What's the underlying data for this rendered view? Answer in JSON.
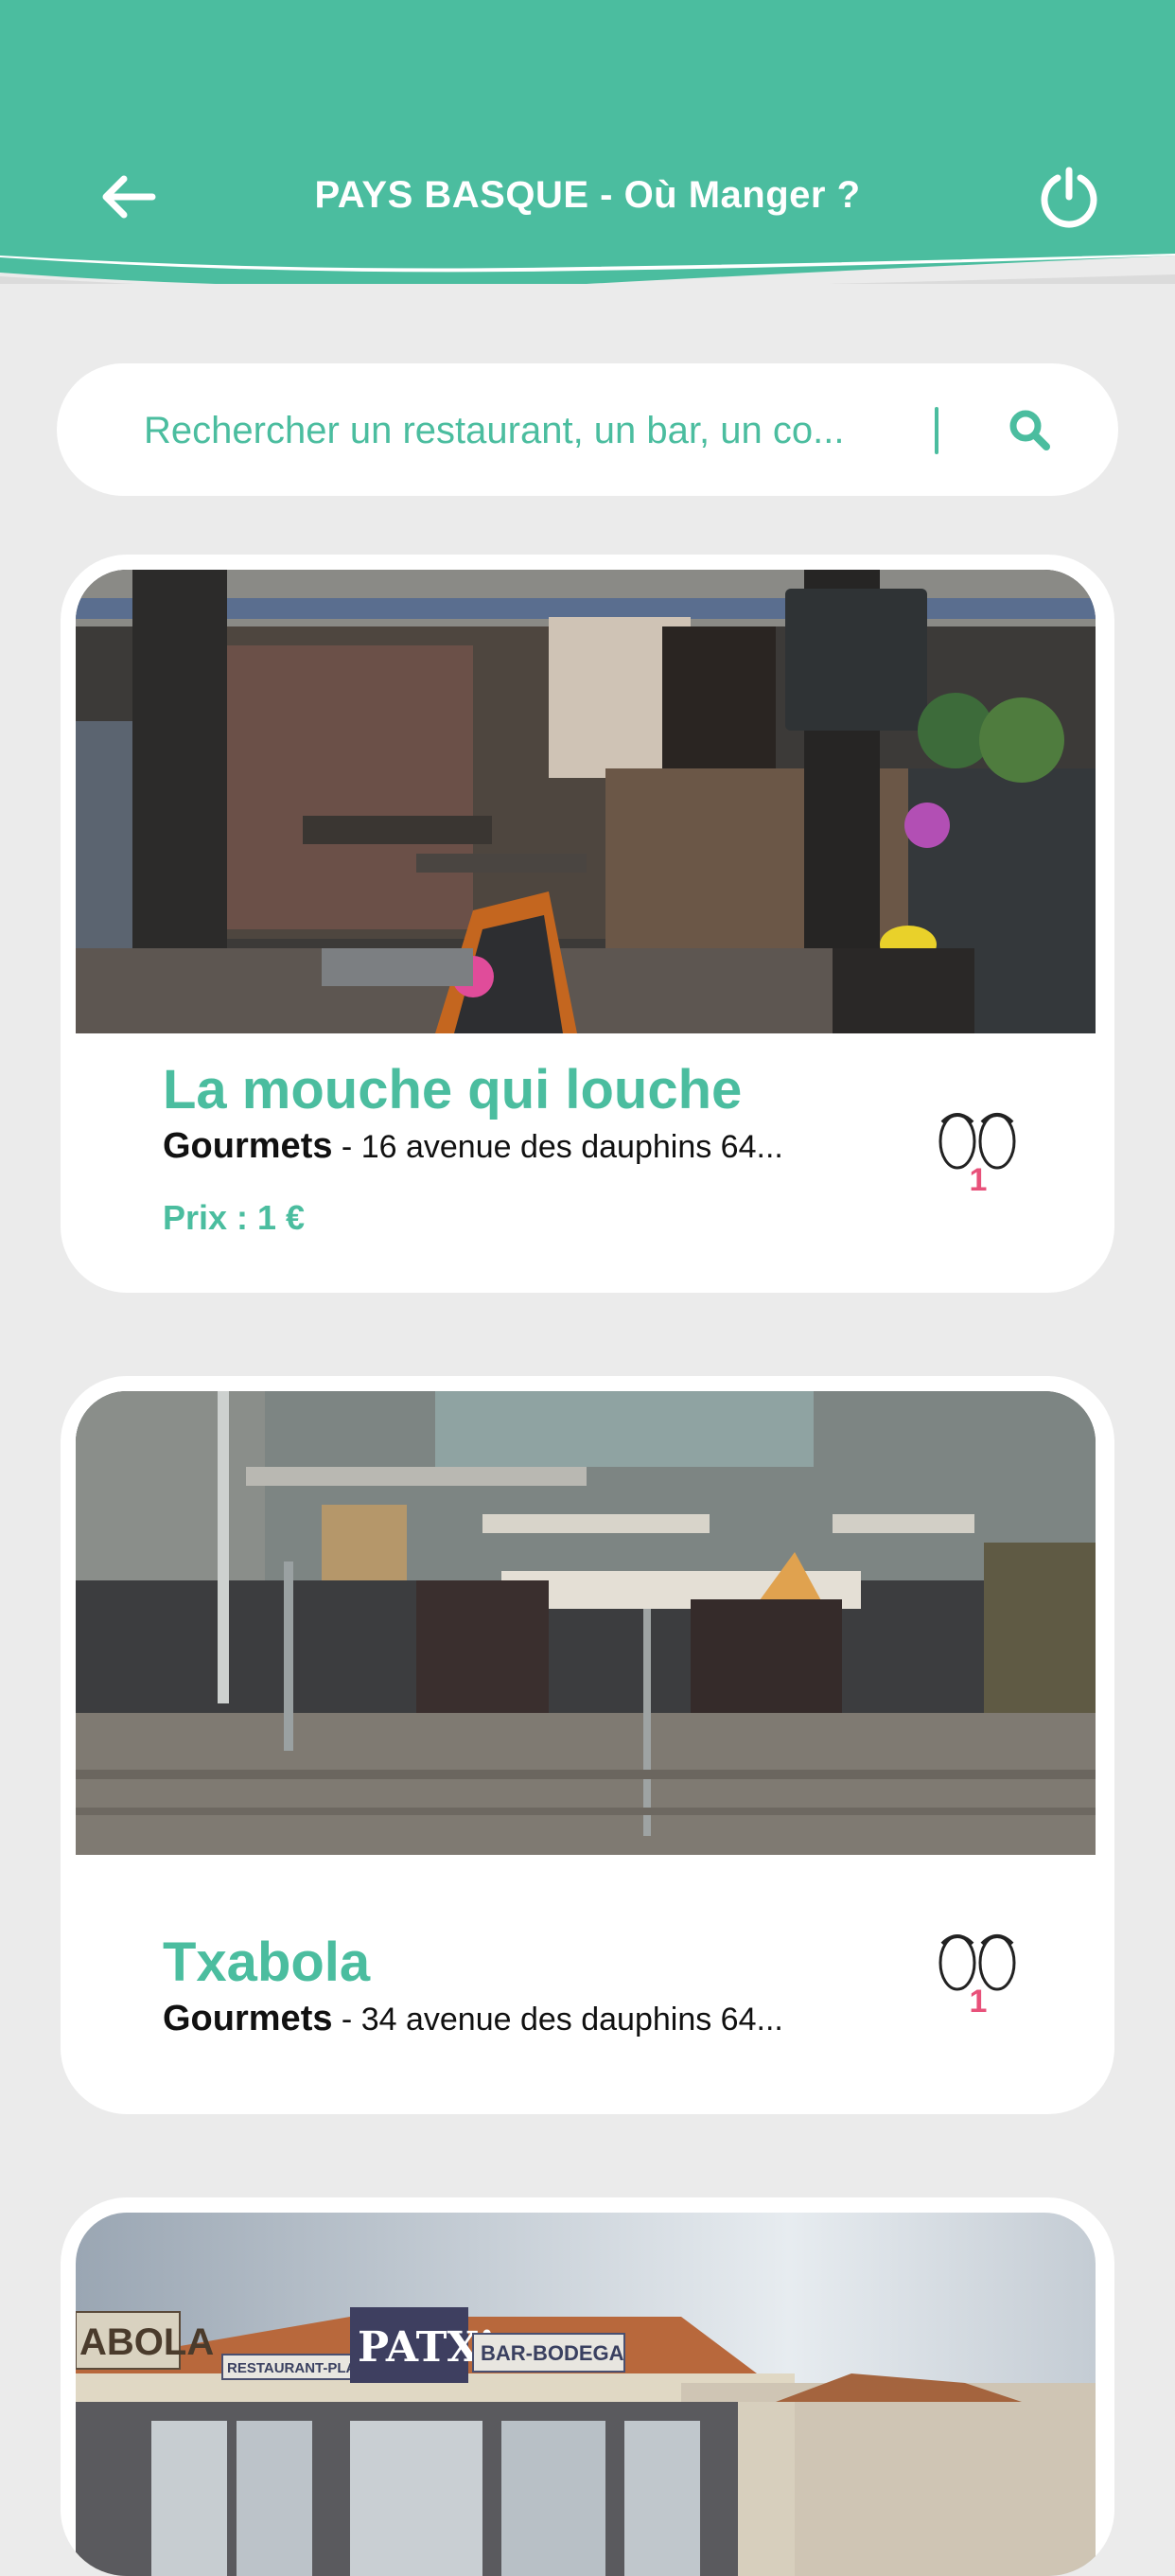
{
  "header": {
    "title": "PAYS BASQUE - Où Manger ?",
    "back_icon": "arrow-left-icon",
    "power_icon": "power-icon",
    "color": "#4bbd9f"
  },
  "search": {
    "placeholder": "Rechercher un restaurant, un bar, un co...",
    "icon": "search-icon"
  },
  "listings": [
    {
      "name": "La mouche qui louche",
      "category": "Gourmets",
      "address": " - 16 avenue des dauphins 64...",
      "price": "Prix : 1 €",
      "views": "1"
    },
    {
      "name": "Txabola",
      "category": "Gourmets",
      "address": " - 34 avenue des dauphins 64...",
      "views": "1"
    },
    {
      "sign_left": "ABOLA",
      "sign_restaurant": "RESTAURANT-PLANCHA",
      "sign_patxi": "PATXi",
      "sign_bar": "BAR-BODEGA"
    }
  ],
  "colors": {
    "accent": "#4bbd9f",
    "count": "#e8517a",
    "background": "#ebebeb"
  }
}
